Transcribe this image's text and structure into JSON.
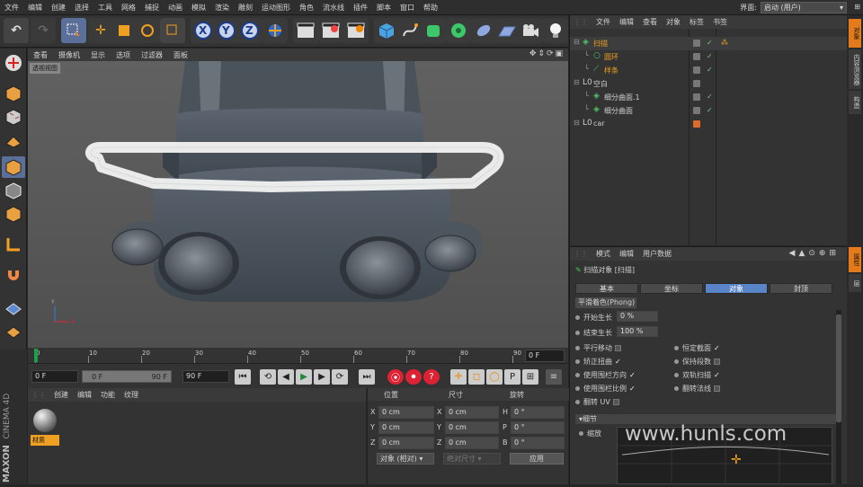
{
  "menubar": {
    "items": [
      "文件",
      "编辑",
      "创建",
      "选择",
      "工具",
      "网格",
      "捕捉",
      "动画",
      "模拟",
      "渲染",
      "雕刻",
      "运动图形",
      "角色",
      "流水线",
      "插件",
      "脚本",
      "窗口",
      "帮助"
    ],
    "layout_label": "界面:",
    "layout_value": "启动 (用户)"
  },
  "viewport": {
    "menu": [
      "查看",
      "摄像机",
      "显示",
      "选项",
      "过滤器",
      "面板"
    ],
    "label": "透视视图"
  },
  "timeline": {
    "ticks": [
      "0",
      "10",
      "20",
      "30",
      "40",
      "50",
      "60",
      "70",
      "80",
      "90"
    ],
    "current_frame": "0 F"
  },
  "transport": {
    "start": "0 F",
    "range_start": "0 F",
    "range_end": "90 F",
    "end": "90 F"
  },
  "materials": {
    "menu": [
      "创建",
      "编辑",
      "功能",
      "纹理"
    ],
    "items": [
      {
        "label": "材质"
      }
    ]
  },
  "brand": {
    "maxon": "MAXON",
    "product": "CINEMA 4D"
  },
  "coords": {
    "headers": [
      "位置",
      "尺寸",
      "旋转"
    ],
    "rows": [
      {
        "axis": "X",
        "pos": "0 cm",
        "saxis": "X",
        "size": "0 cm",
        "raxis": "H",
        "rot": "0 °"
      },
      {
        "axis": "Y",
        "pos": "0 cm",
        "saxis": "Y",
        "size": "0 cm",
        "raxis": "P",
        "rot": "0 °"
      },
      {
        "axis": "Z",
        "pos": "0 cm",
        "saxis": "Z",
        "size": "0 cm",
        "raxis": "B",
        "rot": "0 °"
      }
    ],
    "mode": "对象 (相对)",
    "size_mode": "绝对尺寸",
    "apply": "应用"
  },
  "objects": {
    "menu": [
      "文件",
      "编辑",
      "查看",
      "对象",
      "标签",
      "书签"
    ],
    "rows": [
      {
        "name": "扫描",
        "indent": 0,
        "color": "#f0a020",
        "icon": "sweep-icon"
      },
      {
        "name": "圆环",
        "indent": 1,
        "color": "#f0a020",
        "icon": "circle-spline-icon"
      },
      {
        "name": "样条",
        "indent": 1,
        "color": "#f0a020",
        "icon": "spline-icon"
      },
      {
        "name": "空白",
        "indent": 0,
        "color": "#cfcfcf",
        "icon": "null-icon"
      },
      {
        "name": "细分曲面.1",
        "indent": 1,
        "color": "#cfcfcf",
        "icon": "subdivision-icon"
      },
      {
        "name": "细分曲面",
        "indent": 1,
        "color": "#cfcfcf",
        "icon": "subdivision-icon"
      },
      {
        "name": "car",
        "indent": 0,
        "color": "#cfcfcf",
        "icon": "null-icon"
      }
    ]
  },
  "attributes": {
    "menu": [
      "模式",
      "编辑",
      "用户数据"
    ],
    "title": "扫描对象 [扫描]",
    "tabs": [
      "基本",
      "坐标",
      "对象",
      "封顶"
    ],
    "active_tab": "对象",
    "phong_tab": "平滑着色(Phong)",
    "start_growth_label": "开始生长",
    "start_growth": "0 %",
    "end_growth_label": "结束生长",
    "end_growth": "100 %",
    "options_left": [
      "平行移动",
      "矫正扭曲",
      "使用围栏方向",
      "使用围栏比例",
      "翻转 UV"
    ],
    "options_right": [
      "恒定截面",
      "保持段数",
      "双轨扫描",
      "翻转法线"
    ],
    "details_label": "细节",
    "scale_label": "缩放"
  },
  "right_tabs": [
    "对象",
    "内容浏览器",
    "构造",
    "属性",
    "层"
  ],
  "watermark": "www.hunls.com"
}
